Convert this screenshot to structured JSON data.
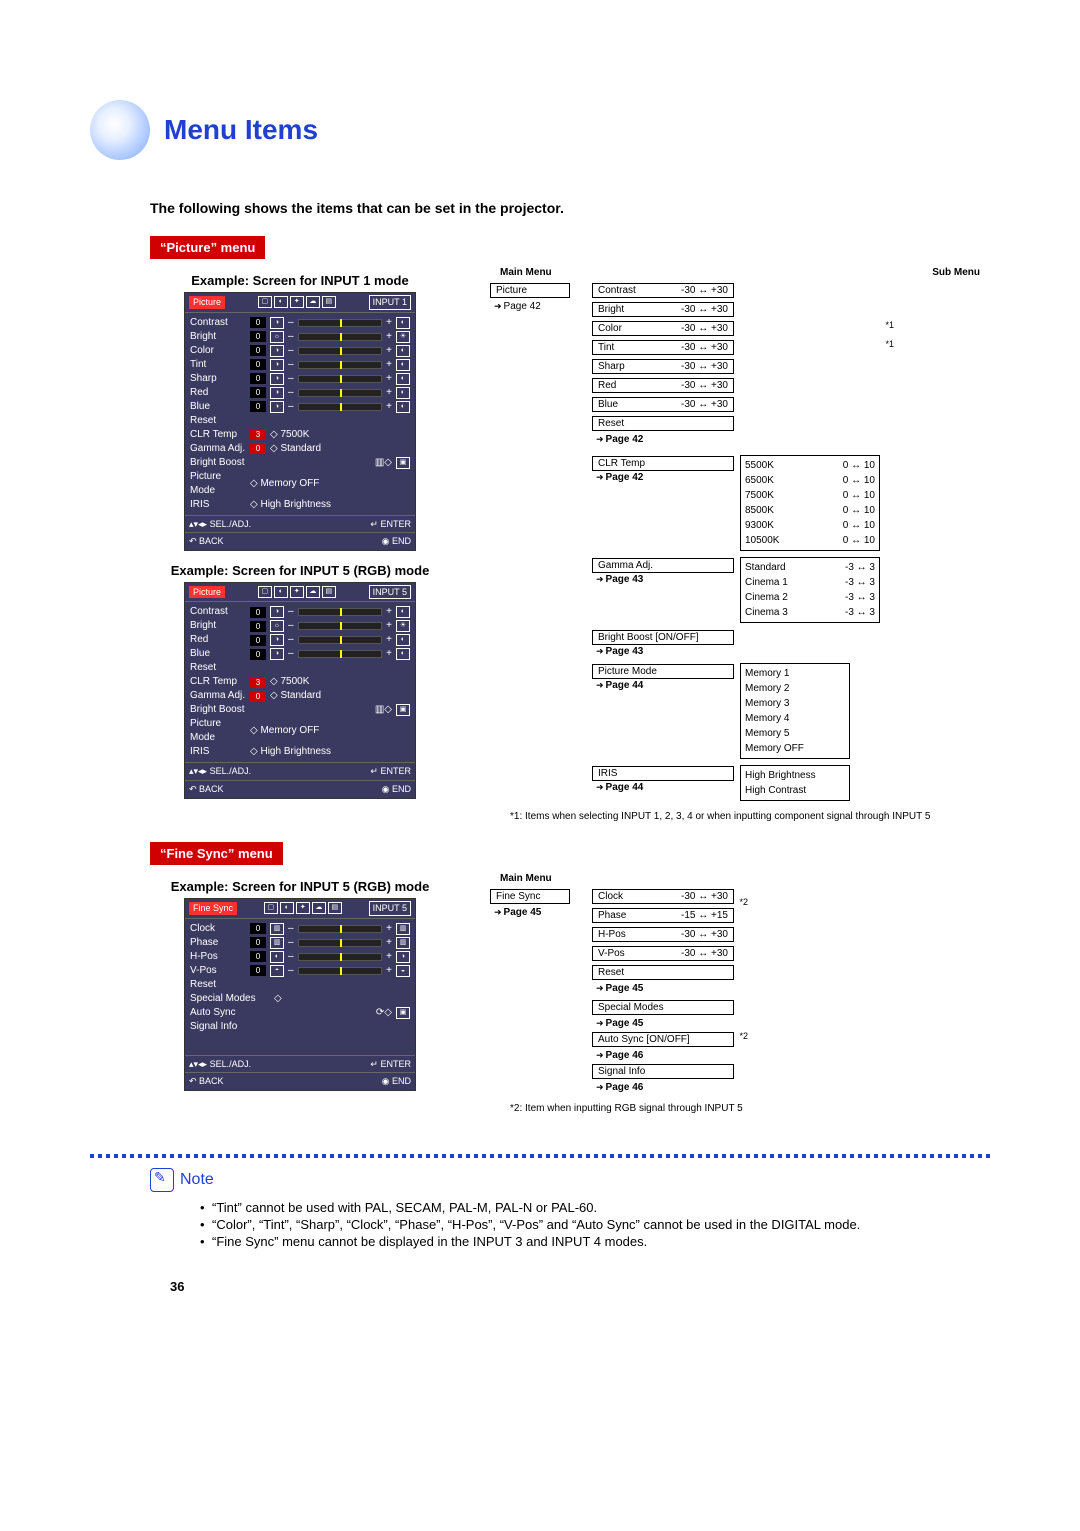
{
  "title": "Menu Items",
  "subtitle": "The following shows the items that can be set in the projector.",
  "picture_menu_label": "“Picture” menu",
  "fine_sync_menu_label": "“Fine Sync” menu",
  "example1_title": "Example: Screen for INPUT 1 mode",
  "example2_title": "Example: Screen for INPUT 5 (RGB) mode",
  "example3_title": "Example: Screen for INPUT 5 (RGB) mode",
  "osd_common": {
    "sel_adj": "SEL./ADJ.",
    "back": "BACK",
    "enter": "ENTER",
    "end": "END"
  },
  "osd1": {
    "tab": "Picture",
    "input": "INPUT 1",
    "rows": [
      "Contrast",
      "Bright",
      "Color",
      "Tint",
      "Sharp",
      "Red",
      "Blue",
      "Reset"
    ],
    "extras": [
      {
        "l": "CLR Temp",
        "v": "3",
        "r": "◇ 7500K"
      },
      {
        "l": "Gamma Adj.",
        "v": "0",
        "r": "◇ Standard"
      },
      {
        "l": "Bright Boost",
        "v": "",
        "r": "▥◇"
      },
      {
        "l": "Picture Mode",
        "v": "",
        "r": "◇ Memory OFF"
      },
      {
        "l": "IRIS",
        "v": "",
        "r": "◇ High Brightness"
      }
    ]
  },
  "osd2": {
    "tab": "Picture",
    "input": "INPUT 5",
    "rows": [
      "Contrast",
      "Bright",
      "Red",
      "Blue",
      "Reset"
    ],
    "extras": [
      {
        "l": "CLR Temp",
        "v": "3",
        "r": "◇ 7500K"
      },
      {
        "l": "Gamma Adj.",
        "v": "0",
        "r": "◇ Standard"
      },
      {
        "l": "Bright Boost",
        "v": "",
        "r": "▥◇"
      },
      {
        "l": "Picture Mode",
        "v": "",
        "r": "◇ Memory OFF"
      },
      {
        "l": "IRIS",
        "v": "",
        "r": "◇ High Brightness"
      }
    ]
  },
  "osd3": {
    "tab": "Fine Sync",
    "input": "INPUT 5",
    "rows": [
      "Clock",
      "Phase",
      "H-Pos",
      "V-Pos",
      "Reset"
    ],
    "extras": [
      {
        "l": "Special Modes",
        "v": "",
        "r": "◇"
      },
      {
        "l": "Auto Sync",
        "v": "",
        "r": "⟳◇"
      },
      {
        "l": "Signal Info",
        "v": "",
        "r": ""
      }
    ]
  },
  "tree1": {
    "main_label": "Main Menu",
    "sub_label": "Sub Menu",
    "root": {
      "name": "Picture",
      "page": "Page 42"
    },
    "simple": [
      {
        "name": "Contrast",
        "range": "-30 ↔ +30"
      },
      {
        "name": "Bright",
        "range": "-30 ↔ +30"
      },
      {
        "name": "Color",
        "range": "-30 ↔ +30",
        "note": "*1"
      },
      {
        "name": "Tint",
        "range": "-30 ↔ +30",
        "note": "*1"
      },
      {
        "name": "Sharp",
        "range": "-30 ↔ +30"
      },
      {
        "name": "Red",
        "range": "-30 ↔ +30"
      },
      {
        "name": "Blue",
        "range": "-30 ↔ +30"
      },
      {
        "name": "Reset",
        "range": ""
      }
    ],
    "simple_page": "Page 42",
    "clr": {
      "name": "CLR Temp",
      "page": "Page 42",
      "opts": [
        {
          "n": "5500K",
          "r": "0 ↔ 10"
        },
        {
          "n": "6500K",
          "r": "0 ↔ 10"
        },
        {
          "n": "7500K",
          "r": "0 ↔ 10"
        },
        {
          "n": "8500K",
          "r": "0 ↔ 10"
        },
        {
          "n": "9300K",
          "r": "0 ↔ 10"
        },
        {
          "n": "10500K",
          "r": "0 ↔ 10"
        }
      ]
    },
    "gamma": {
      "name": "Gamma Adj.",
      "page": "Page 43",
      "opts": [
        {
          "n": "Standard",
          "r": "-3 ↔ 3"
        },
        {
          "n": "Cinema 1",
          "r": "-3 ↔ 3"
        },
        {
          "n": "Cinema 2",
          "r": "-3 ↔ 3"
        },
        {
          "n": "Cinema 3",
          "r": "-3 ↔ 3"
        }
      ]
    },
    "boost": {
      "name": "Bright Boost  [ON/OFF]",
      "page": "Page 43"
    },
    "pmode": {
      "name": "Picture Mode",
      "page": "Page 44",
      "opts": [
        "Memory 1",
        "Memory 2",
        "Memory 3",
        "Memory 4",
        "Memory 5",
        "Memory OFF"
      ]
    },
    "iris": {
      "name": "IRIS",
      "page": "Page 44",
      "opts": [
        "High Brightness",
        "High Contrast"
      ]
    }
  },
  "tree1_footnote": "*1: Items when selecting INPUT 1, 2, 3, 4 or when inputting component signal through INPUT 5",
  "tree2": {
    "main_label": "Main Menu",
    "root": {
      "name": "Fine Sync",
      "page": "Page 45"
    },
    "simple": [
      {
        "name": "Clock",
        "range": "-30 ↔ +30"
      },
      {
        "name": "Phase",
        "range": "-15 ↔ +15"
      },
      {
        "name": "H-Pos",
        "range": "-30 ↔ +30"
      },
      {
        "name": "V-Pos",
        "range": "-30 ↔ +30"
      },
      {
        "name": "Reset",
        "range": ""
      }
    ],
    "note_marker": "*2",
    "simple_page": "Page 45",
    "special": {
      "name": "Special Modes",
      "page": "Page 45"
    },
    "auto": {
      "name": "Auto Sync [ON/OFF]",
      "page": "Page 46",
      "note": "*2"
    },
    "signal": {
      "name": "Signal Info",
      "page": "Page 46"
    }
  },
  "tree2_footnote": "*2: Item when inputting RGB signal through INPUT 5",
  "note_label": "Note",
  "notes": [
    "“Tint” cannot be used with PAL, SECAM, PAL-M, PAL-N or PAL-60.",
    "“Color”, “Tint”, “Sharp”, “Clock”, “Phase”, “H-Pos”, “V-Pos” and “Auto Sync” cannot be used in the DIGITAL mode.",
    "“Fine Sync” menu cannot be displayed in the INPUT 3 and INPUT 4 modes."
  ],
  "page_number": "36"
}
